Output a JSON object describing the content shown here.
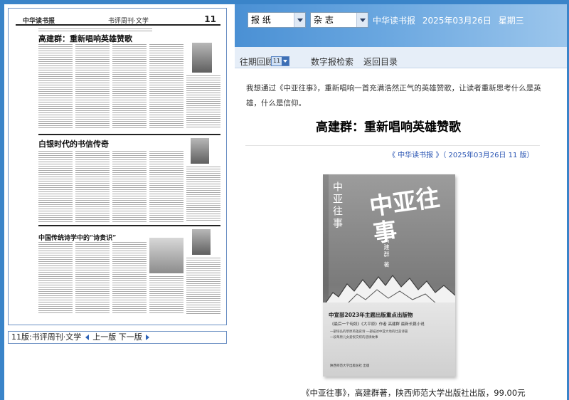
{
  "header": {
    "paper_select": "报 纸",
    "magazine_select": "杂 志",
    "date_line": "中华读书报",
    "date": "2025年03月26日",
    "weekday": "星期三"
  },
  "toolbar": {
    "past_review": "往期回顾",
    "issue_value": "11",
    "digital_search": "数字报检索",
    "back_to_index": "返回目录"
  },
  "newspaper": {
    "logo": "中华读书报",
    "page_name": "书评周刊·文学",
    "page_number": "11",
    "headline1": "高建群：重新唱响英雄赞歌",
    "headline2": "白银时代的书信传奇",
    "headline3": "中国传统诗学中的“诗贵识”"
  },
  "page_nav": {
    "section": "11版:书评周刊·文学",
    "prev": "上一版",
    "next": "下一版"
  },
  "article": {
    "summary": "我想通过《中亚往事》，重新唱响一首充满浩然正气的英雄赞歌，让读者重新思考什么是英雄，什么是信仰。",
    "title": "高建群：重新唱响英雄赞歌",
    "source": "《 中华读书报 》（ 2025年03月26日   11 版）",
    "caption": "《中亚往事》，高建群著，陕西师范大学出版社出版，99.00元"
  },
  "cover": {
    "vertical_title": "中亚往事",
    "big_title": "中亚往事",
    "author": "高建群 著",
    "tagline": "中宣部2023年主题出版重点出版物",
    "sub1": "《最后一个匈奴》《大平原》作者 高建群 最新长篇小说",
    "sub2": "一部恢弘的草原英雄史诗   一部描述中亚大地的壮美诗篇",
    "sub3": "一段草原儿女爱恨交织的悲情故事",
    "publisher": "陕西师范大学出版总社   出版"
  },
  "colors": {
    "frame_blue": "#3a84c9",
    "link_blue": "#2a55b3",
    "toolbar_bg": "#e6eef8"
  }
}
